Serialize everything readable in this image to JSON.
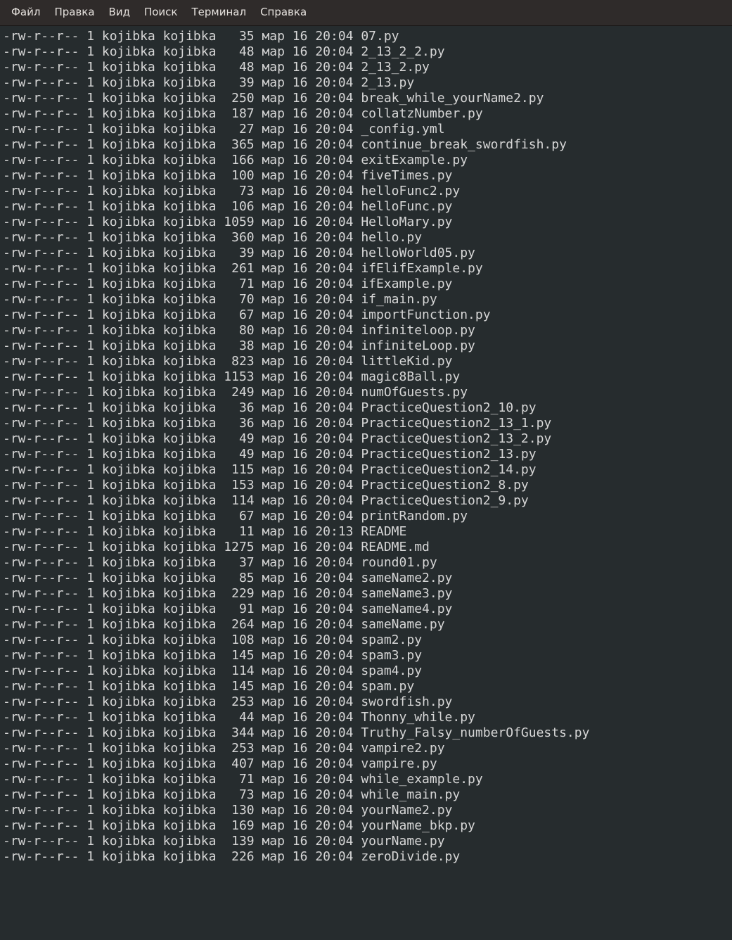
{
  "menu": {
    "file": "Файл",
    "edit": "Правка",
    "view": "Вид",
    "search": "Поиск",
    "terminal": "Терминал",
    "help": "Справка"
  },
  "listing": [
    {
      "perm": "-rw-r--r--",
      "links": "1",
      "owner": "kojibka",
      "group": "kojibka",
      "size": "35",
      "month": "мар",
      "day": "16",
      "time": "20:04",
      "name": "07.py"
    },
    {
      "perm": "-rw-r--r--",
      "links": "1",
      "owner": "kojibka",
      "group": "kojibka",
      "size": "48",
      "month": "мар",
      "day": "16",
      "time": "20:04",
      "name": "2_13_2_2.py"
    },
    {
      "perm": "-rw-r--r--",
      "links": "1",
      "owner": "kojibka",
      "group": "kojibka",
      "size": "48",
      "month": "мар",
      "day": "16",
      "time": "20:04",
      "name": "2_13_2.py"
    },
    {
      "perm": "-rw-r--r--",
      "links": "1",
      "owner": "kojibka",
      "group": "kojibka",
      "size": "39",
      "month": "мар",
      "day": "16",
      "time": "20:04",
      "name": "2_13.py"
    },
    {
      "perm": "-rw-r--r--",
      "links": "1",
      "owner": "kojibka",
      "group": "kojibka",
      "size": "250",
      "month": "мар",
      "day": "16",
      "time": "20:04",
      "name": "break_while_yourName2.py"
    },
    {
      "perm": "-rw-r--r--",
      "links": "1",
      "owner": "kojibka",
      "group": "kojibka",
      "size": "187",
      "month": "мар",
      "day": "16",
      "time": "20:04",
      "name": "collatzNumber.py"
    },
    {
      "perm": "-rw-r--r--",
      "links": "1",
      "owner": "kojibka",
      "group": "kojibka",
      "size": "27",
      "month": "мар",
      "day": "16",
      "time": "20:04",
      "name": "_config.yml"
    },
    {
      "perm": "-rw-r--r--",
      "links": "1",
      "owner": "kojibka",
      "group": "kojibka",
      "size": "365",
      "month": "мар",
      "day": "16",
      "time": "20:04",
      "name": "continue_break_swordfish.py"
    },
    {
      "perm": "-rw-r--r--",
      "links": "1",
      "owner": "kojibka",
      "group": "kojibka",
      "size": "166",
      "month": "мар",
      "day": "16",
      "time": "20:04",
      "name": "exitExample.py"
    },
    {
      "perm": "-rw-r--r--",
      "links": "1",
      "owner": "kojibka",
      "group": "kojibka",
      "size": "100",
      "month": "мар",
      "day": "16",
      "time": "20:04",
      "name": "fiveTimes.py"
    },
    {
      "perm": "-rw-r--r--",
      "links": "1",
      "owner": "kojibka",
      "group": "kojibka",
      "size": "73",
      "month": "мар",
      "day": "16",
      "time": "20:04",
      "name": "helloFunc2.py"
    },
    {
      "perm": "-rw-r--r--",
      "links": "1",
      "owner": "kojibka",
      "group": "kojibka",
      "size": "106",
      "month": "мар",
      "day": "16",
      "time": "20:04",
      "name": "helloFunc.py"
    },
    {
      "perm": "-rw-r--r--",
      "links": "1",
      "owner": "kojibka",
      "group": "kojibka",
      "size": "1059",
      "month": "мар",
      "day": "16",
      "time": "20:04",
      "name": "HelloMary.py"
    },
    {
      "perm": "-rw-r--r--",
      "links": "1",
      "owner": "kojibka",
      "group": "kojibka",
      "size": "360",
      "month": "мар",
      "day": "16",
      "time": "20:04",
      "name": "hello.py"
    },
    {
      "perm": "-rw-r--r--",
      "links": "1",
      "owner": "kojibka",
      "group": "kojibka",
      "size": "39",
      "month": "мар",
      "day": "16",
      "time": "20:04",
      "name": "helloWorld05.py"
    },
    {
      "perm": "-rw-r--r--",
      "links": "1",
      "owner": "kojibka",
      "group": "kojibka",
      "size": "261",
      "month": "мар",
      "day": "16",
      "time": "20:04",
      "name": "ifElifExample.py"
    },
    {
      "perm": "-rw-r--r--",
      "links": "1",
      "owner": "kojibka",
      "group": "kojibka",
      "size": "71",
      "month": "мар",
      "day": "16",
      "time": "20:04",
      "name": "ifExample.py"
    },
    {
      "perm": "-rw-r--r--",
      "links": "1",
      "owner": "kojibka",
      "group": "kojibka",
      "size": "70",
      "month": "мар",
      "day": "16",
      "time": "20:04",
      "name": "if_main.py"
    },
    {
      "perm": "-rw-r--r--",
      "links": "1",
      "owner": "kojibka",
      "group": "kojibka",
      "size": "67",
      "month": "мар",
      "day": "16",
      "time": "20:04",
      "name": "importFunction.py"
    },
    {
      "perm": "-rw-r--r--",
      "links": "1",
      "owner": "kojibka",
      "group": "kojibka",
      "size": "80",
      "month": "мар",
      "day": "16",
      "time": "20:04",
      "name": "infiniteloop.py"
    },
    {
      "perm": "-rw-r--r--",
      "links": "1",
      "owner": "kojibka",
      "group": "kojibka",
      "size": "38",
      "month": "мар",
      "day": "16",
      "time": "20:04",
      "name": "infiniteLoop.py"
    },
    {
      "perm": "-rw-r--r--",
      "links": "1",
      "owner": "kojibka",
      "group": "kojibka",
      "size": "823",
      "month": "мар",
      "day": "16",
      "time": "20:04",
      "name": "littleKid.py"
    },
    {
      "perm": "-rw-r--r--",
      "links": "1",
      "owner": "kojibka",
      "group": "kojibka",
      "size": "1153",
      "month": "мар",
      "day": "16",
      "time": "20:04",
      "name": "magic8Ball.py"
    },
    {
      "perm": "-rw-r--r--",
      "links": "1",
      "owner": "kojibka",
      "group": "kojibka",
      "size": "249",
      "month": "мар",
      "day": "16",
      "time": "20:04",
      "name": "numOfGuests.py"
    },
    {
      "perm": "-rw-r--r--",
      "links": "1",
      "owner": "kojibka",
      "group": "kojibka",
      "size": "36",
      "month": "мар",
      "day": "16",
      "time": "20:04",
      "name": "PracticeQuestion2_10.py"
    },
    {
      "perm": "-rw-r--r--",
      "links": "1",
      "owner": "kojibka",
      "group": "kojibka",
      "size": "36",
      "month": "мар",
      "day": "16",
      "time": "20:04",
      "name": "PracticeQuestion2_13_1.py"
    },
    {
      "perm": "-rw-r--r--",
      "links": "1",
      "owner": "kojibka",
      "group": "kojibka",
      "size": "49",
      "month": "мар",
      "day": "16",
      "time": "20:04",
      "name": "PracticeQuestion2_13_2.py"
    },
    {
      "perm": "-rw-r--r--",
      "links": "1",
      "owner": "kojibka",
      "group": "kojibka",
      "size": "49",
      "month": "мар",
      "day": "16",
      "time": "20:04",
      "name": "PracticeQuestion2_13.py"
    },
    {
      "perm": "-rw-r--r--",
      "links": "1",
      "owner": "kojibka",
      "group": "kojibka",
      "size": "115",
      "month": "мар",
      "day": "16",
      "time": "20:04",
      "name": "PracticeQuestion2_14.py"
    },
    {
      "perm": "-rw-r--r--",
      "links": "1",
      "owner": "kojibka",
      "group": "kojibka",
      "size": "153",
      "month": "мар",
      "day": "16",
      "time": "20:04",
      "name": "PracticeQuestion2_8.py"
    },
    {
      "perm": "-rw-r--r--",
      "links": "1",
      "owner": "kojibka",
      "group": "kojibka",
      "size": "114",
      "month": "мар",
      "day": "16",
      "time": "20:04",
      "name": "PracticeQuestion2_9.py"
    },
    {
      "perm": "-rw-r--r--",
      "links": "1",
      "owner": "kojibka",
      "group": "kojibka",
      "size": "67",
      "month": "мар",
      "day": "16",
      "time": "20:04",
      "name": "printRandom.py"
    },
    {
      "perm": "-rw-r--r--",
      "links": "1",
      "owner": "kojibka",
      "group": "kojibka",
      "size": "11",
      "month": "мар",
      "day": "16",
      "time": "20:13",
      "name": "README"
    },
    {
      "perm": "-rw-r--r--",
      "links": "1",
      "owner": "kojibka",
      "group": "kojibka",
      "size": "1275",
      "month": "мар",
      "day": "16",
      "time": "20:04",
      "name": "README.md"
    },
    {
      "perm": "-rw-r--r--",
      "links": "1",
      "owner": "kojibka",
      "group": "kojibka",
      "size": "37",
      "month": "мар",
      "day": "16",
      "time": "20:04",
      "name": "round01.py"
    },
    {
      "perm": "-rw-r--r--",
      "links": "1",
      "owner": "kojibka",
      "group": "kojibka",
      "size": "85",
      "month": "мар",
      "day": "16",
      "time": "20:04",
      "name": "sameName2.py"
    },
    {
      "perm": "-rw-r--r--",
      "links": "1",
      "owner": "kojibka",
      "group": "kojibka",
      "size": "229",
      "month": "мар",
      "day": "16",
      "time": "20:04",
      "name": "sameName3.py"
    },
    {
      "perm": "-rw-r--r--",
      "links": "1",
      "owner": "kojibka",
      "group": "kojibka",
      "size": "91",
      "month": "мар",
      "day": "16",
      "time": "20:04",
      "name": "sameName4.py"
    },
    {
      "perm": "-rw-r--r--",
      "links": "1",
      "owner": "kojibka",
      "group": "kojibka",
      "size": "264",
      "month": "мар",
      "day": "16",
      "time": "20:04",
      "name": "sameName.py"
    },
    {
      "perm": "-rw-r--r--",
      "links": "1",
      "owner": "kojibka",
      "group": "kojibka",
      "size": "108",
      "month": "мар",
      "day": "16",
      "time": "20:04",
      "name": "spam2.py"
    },
    {
      "perm": "-rw-r--r--",
      "links": "1",
      "owner": "kojibka",
      "group": "kojibka",
      "size": "145",
      "month": "мар",
      "day": "16",
      "time": "20:04",
      "name": "spam3.py"
    },
    {
      "perm": "-rw-r--r--",
      "links": "1",
      "owner": "kojibka",
      "group": "kojibka",
      "size": "114",
      "month": "мар",
      "day": "16",
      "time": "20:04",
      "name": "spam4.py"
    },
    {
      "perm": "-rw-r--r--",
      "links": "1",
      "owner": "kojibka",
      "group": "kojibka",
      "size": "145",
      "month": "мар",
      "day": "16",
      "time": "20:04",
      "name": "spam.py"
    },
    {
      "perm": "-rw-r--r--",
      "links": "1",
      "owner": "kojibka",
      "group": "kojibka",
      "size": "253",
      "month": "мар",
      "day": "16",
      "time": "20:04",
      "name": "swordfish.py"
    },
    {
      "perm": "-rw-r--r--",
      "links": "1",
      "owner": "kojibka",
      "group": "kojibka",
      "size": "44",
      "month": "мар",
      "day": "16",
      "time": "20:04",
      "name": "Thonny_while.py"
    },
    {
      "perm": "-rw-r--r--",
      "links": "1",
      "owner": "kojibka",
      "group": "kojibka",
      "size": "344",
      "month": "мар",
      "day": "16",
      "time": "20:04",
      "name": "Truthy_Falsy_numberOfGuests.py"
    },
    {
      "perm": "-rw-r--r--",
      "links": "1",
      "owner": "kojibka",
      "group": "kojibka",
      "size": "253",
      "month": "мар",
      "day": "16",
      "time": "20:04",
      "name": "vampire2.py"
    },
    {
      "perm": "-rw-r--r--",
      "links": "1",
      "owner": "kojibka",
      "group": "kojibka",
      "size": "407",
      "month": "мар",
      "day": "16",
      "time": "20:04",
      "name": "vampire.py"
    },
    {
      "perm": "-rw-r--r--",
      "links": "1",
      "owner": "kojibka",
      "group": "kojibka",
      "size": "71",
      "month": "мар",
      "day": "16",
      "time": "20:04",
      "name": "while_example.py"
    },
    {
      "perm": "-rw-r--r--",
      "links": "1",
      "owner": "kojibka",
      "group": "kojibka",
      "size": "73",
      "month": "мар",
      "day": "16",
      "time": "20:04",
      "name": "while_main.py"
    },
    {
      "perm": "-rw-r--r--",
      "links": "1",
      "owner": "kojibka",
      "group": "kojibka",
      "size": "130",
      "month": "мар",
      "day": "16",
      "time": "20:04",
      "name": "yourName2.py"
    },
    {
      "perm": "-rw-r--r--",
      "links": "1",
      "owner": "kojibka",
      "group": "kojibka",
      "size": "169",
      "month": "мар",
      "day": "16",
      "time": "20:04",
      "name": "yourName_bkp.py"
    },
    {
      "perm": "-rw-r--r--",
      "links": "1",
      "owner": "kojibka",
      "group": "kojibka",
      "size": "139",
      "month": "мар",
      "day": "16",
      "time": "20:04",
      "name": "yourName.py"
    },
    {
      "perm": "-rw-r--r--",
      "links": "1",
      "owner": "kojibka",
      "group": "kojibka",
      "size": "226",
      "month": "мар",
      "day": "16",
      "time": "20:04",
      "name": "zeroDivide.py"
    }
  ]
}
